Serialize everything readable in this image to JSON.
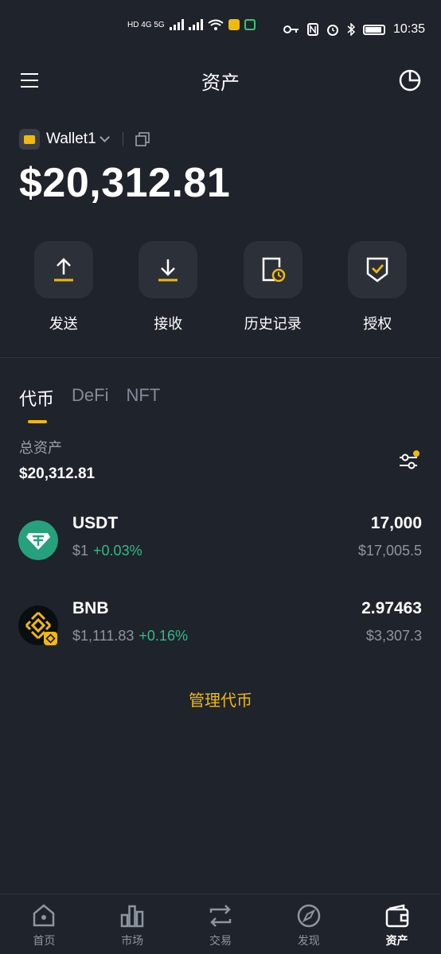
{
  "status_bar": {
    "network_left": "HD 4G 5G",
    "time": "10:35"
  },
  "header": {
    "title": "资产"
  },
  "wallet": {
    "name": "Wallet1",
    "balance": "$20,312.81"
  },
  "actions": [
    {
      "label": "发送",
      "icon": "send-icon"
    },
    {
      "label": "接收",
      "icon": "receive-icon"
    },
    {
      "label": "历史记录",
      "icon": "history-icon"
    },
    {
      "label": "授权",
      "icon": "authorize-icon"
    }
  ],
  "tabs": [
    {
      "label": "代币",
      "active": true
    },
    {
      "label": "DeFi",
      "active": false
    },
    {
      "label": "NFT",
      "active": false
    }
  ],
  "summary": {
    "total_label": "总资产",
    "total_value": "$20,312.81"
  },
  "tokens": [
    {
      "symbol": "USDT",
      "price": "$1",
      "change": "+0.03%",
      "amount": "17,000",
      "value": "$17,005.5",
      "color": "#26a17b"
    },
    {
      "symbol": "BNB",
      "price": "$1,111.83",
      "change": "+0.16%",
      "amount": "2.97463",
      "value": "$3,307.3",
      "color": "#f0b90b"
    }
  ],
  "manage_label": "管理代币",
  "bottom_nav": [
    {
      "label": "首页",
      "icon": "home-icon"
    },
    {
      "label": "市场",
      "icon": "market-icon"
    },
    {
      "label": "交易",
      "icon": "trade-icon"
    },
    {
      "label": "发现",
      "icon": "discover-icon"
    },
    {
      "label": "资产",
      "icon": "assets-icon",
      "active": true
    }
  ],
  "colors": {
    "accent": "#f0b90b",
    "background": "#1f232b",
    "positive": "#2ebd85"
  }
}
